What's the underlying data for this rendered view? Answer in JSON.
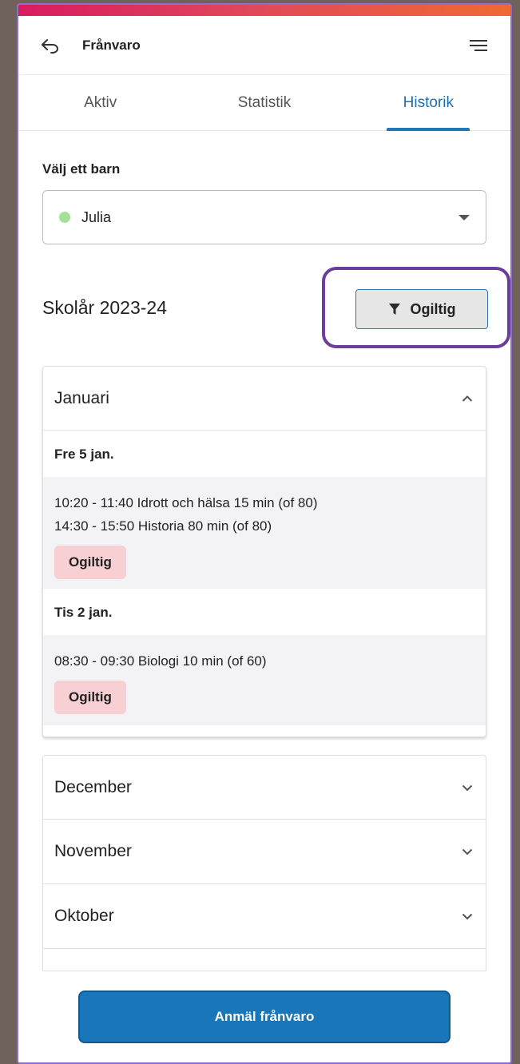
{
  "header": {
    "title": "Frånvaro",
    "back_icon": "back-arrow-icon",
    "menu_icon": "hamburger-menu-icon"
  },
  "tabs": [
    {
      "label": "Aktiv",
      "active": false
    },
    {
      "label": "Statistik",
      "active": false
    },
    {
      "label": "Historik",
      "active": true
    }
  ],
  "child_select": {
    "label": "Välj ett barn",
    "value": "Julia",
    "dot_color": "#a6df9a"
  },
  "school_year": {
    "title": "Skolår 2023-24",
    "filter_label": "Ogiltig",
    "filter_icon": "filter-funnel-icon"
  },
  "expanded_month": {
    "name": "Januari",
    "days": [
      {
        "title": "Fre 5 jan.",
        "entries": [
          "10:20 - 11:40 Idrott och hälsa 15 min (of 80)",
          "14:30 - 15:50 Historia 80 min (of 80)"
        ],
        "badge": "Ogiltig"
      },
      {
        "title": "Tis 2 jan.",
        "entries": [
          "08:30 - 09:30 Biologi 10 min (of 60)"
        ],
        "badge": "Ogiltig"
      }
    ]
  },
  "collapsed_months": [
    "December",
    "November",
    "Oktober"
  ],
  "footer": {
    "report_button": "Anmäl frånvaro"
  },
  "colors": {
    "accent": "#1976b9",
    "badge_bg": "#f8cfd2",
    "highlight": "#6a3e9c"
  }
}
